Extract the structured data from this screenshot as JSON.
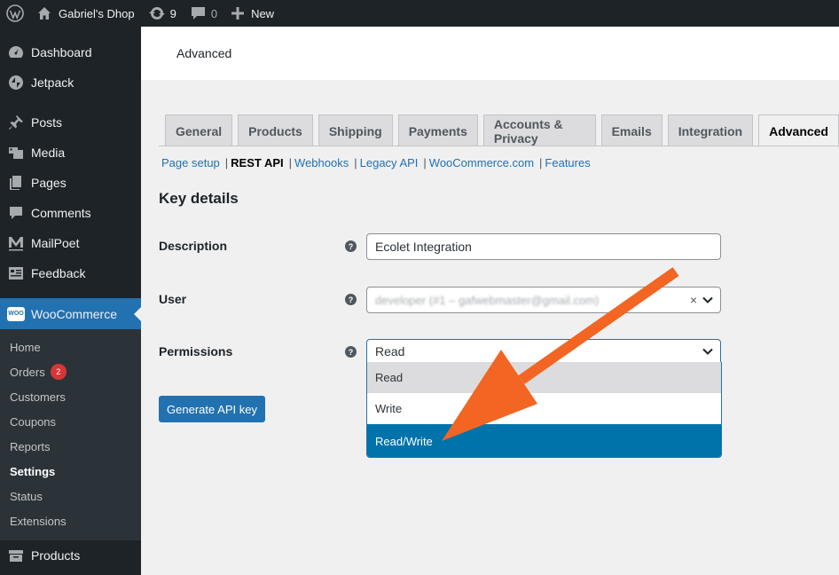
{
  "admin_bar": {
    "site_name": "Gabriel's Dhop",
    "updates_count": "9",
    "comments_count": "0",
    "new_label": "New"
  },
  "sidebar": {
    "items": [
      {
        "label": "Dashboard",
        "icon": "dashboard-icon"
      },
      {
        "label": "Jetpack",
        "icon": "jetpack-icon"
      },
      {
        "label": "Posts",
        "icon": "pin-icon"
      },
      {
        "label": "Media",
        "icon": "media-icon"
      },
      {
        "label": "Pages",
        "icon": "pages-icon"
      },
      {
        "label": "Comments",
        "icon": "comment-icon"
      },
      {
        "label": "MailPoet",
        "icon": "mailpoet-icon"
      },
      {
        "label": "Feedback",
        "icon": "feedback-icon"
      },
      {
        "label": "WooCommerce",
        "icon": "woocommerce-icon"
      }
    ],
    "woo_badge": "WOO",
    "submenu": [
      {
        "label": "Home"
      },
      {
        "label": "Orders",
        "badge": "2"
      },
      {
        "label": "Customers"
      },
      {
        "label": "Coupons"
      },
      {
        "label": "Reports"
      },
      {
        "label": "Settings"
      },
      {
        "label": "Status"
      },
      {
        "label": "Extensions"
      }
    ],
    "products_label": "Products"
  },
  "header": {
    "title": "Advanced"
  },
  "tabs": [
    {
      "label": "General"
    },
    {
      "label": "Products"
    },
    {
      "label": "Shipping"
    },
    {
      "label": "Payments"
    },
    {
      "label": "Accounts & Privacy"
    },
    {
      "label": "Emails"
    },
    {
      "label": "Integration"
    },
    {
      "label": "Advanced"
    }
  ],
  "subsections": [
    {
      "label": "Page setup"
    },
    {
      "label": "REST API"
    },
    {
      "label": "Webhooks"
    },
    {
      "label": "Legacy API"
    },
    {
      "label": "WooCommerce.com"
    },
    {
      "label": "Features"
    }
  ],
  "form": {
    "section_title": "Key details",
    "description_label": "Description",
    "description_value": "Ecolet Integration",
    "user_label": "User",
    "user_value": "developer (#1 – gafwebmaster@gmail.com)",
    "permissions_label": "Permissions",
    "permissions_value": "Read",
    "permission_options": [
      "Read",
      "Write",
      "Read/Write"
    ],
    "help_glyph": "?",
    "clear_glyph": "×",
    "generate_button": "Generate API key"
  },
  "colors": {
    "accent": "#2271b1",
    "selected_option": "#0073aa",
    "annotation_arrow": "#f26522"
  }
}
